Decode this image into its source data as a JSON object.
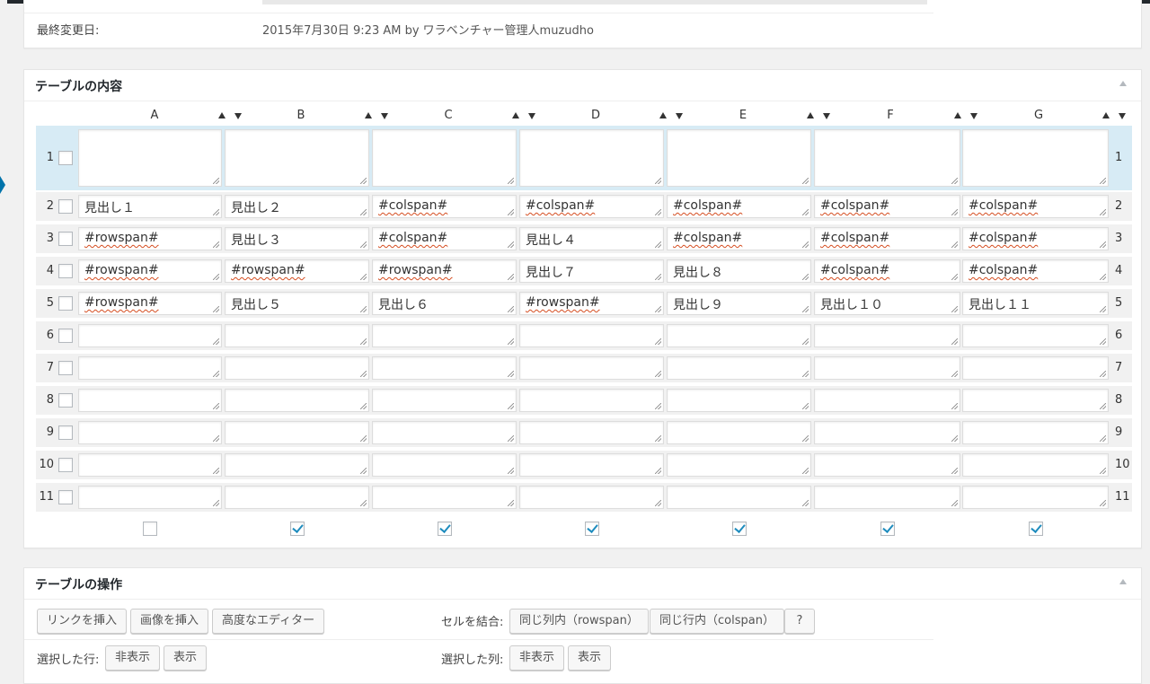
{
  "last_modified": {
    "label": "最終変更日:",
    "value": "2015年7月30日 9:23 AM by ワラベンチャー管理人muzudho"
  },
  "table_content": {
    "title": "テーブルの内容",
    "columns": [
      "A",
      "B",
      "C",
      "D",
      "E",
      "F",
      "G"
    ],
    "rows": [
      {
        "num": "1",
        "cells": [
          "",
          "",
          "",
          "",
          "",
          "",
          ""
        ]
      },
      {
        "num": "2",
        "cells": [
          "見出し１",
          "見出し２",
          "#colspan#",
          "#colspan#",
          "#colspan#",
          "#colspan#",
          "#colspan#"
        ]
      },
      {
        "num": "3",
        "cells": [
          "#rowspan#",
          "見出し３",
          "#colspan#",
          "見出し４",
          "#colspan#",
          "#colspan#",
          "#colspan#"
        ]
      },
      {
        "num": "4",
        "cells": [
          "#rowspan#",
          "#rowspan#",
          "#rowspan#",
          "見出し７",
          "見出し８",
          "#colspan#",
          "#colspan#"
        ]
      },
      {
        "num": "5",
        "cells": [
          "#rowspan#",
          "見出し５",
          "見出し６",
          "#rowspan#",
          "見出し９",
          "見出し１０",
          "見出し１１"
        ]
      },
      {
        "num": "6",
        "cells": [
          "",
          "",
          "",
          "",
          "",
          "",
          ""
        ]
      },
      {
        "num": "7",
        "cells": [
          "",
          "",
          "",
          "",
          "",
          "",
          ""
        ]
      },
      {
        "num": "8",
        "cells": [
          "",
          "",
          "",
          "",
          "",
          "",
          ""
        ]
      },
      {
        "num": "9",
        "cells": [
          "",
          "",
          "",
          "",
          "",
          "",
          ""
        ]
      },
      {
        "num": "10",
        "cells": [
          "",
          "",
          "",
          "",
          "",
          "",
          ""
        ]
      },
      {
        "num": "11",
        "cells": [
          "",
          "",
          "",
          "",
          "",
          "",
          ""
        ]
      }
    ],
    "column_checks": [
      false,
      true,
      true,
      true,
      true,
      true,
      true
    ]
  },
  "table_operations": {
    "title": "テーブルの操作",
    "insert_link": "リンクを挿入",
    "insert_image": "画像を挿入",
    "advanced_editor": "高度なエディター",
    "merge_label": "セルを結合:",
    "merge_rowspan": "同じ列内（rowspan）",
    "merge_colspan": "同じ行内（colspan）",
    "help": "?",
    "selected_rows_label": "選択した行:",
    "selected_cols_label": "選択した列:",
    "hide": "非表示",
    "show": "表示"
  },
  "colors": {
    "accent": "#0073aa",
    "highlight_row": "#d7ebf5",
    "check": "#1e8cbe",
    "error_underline": "#d54e21"
  }
}
